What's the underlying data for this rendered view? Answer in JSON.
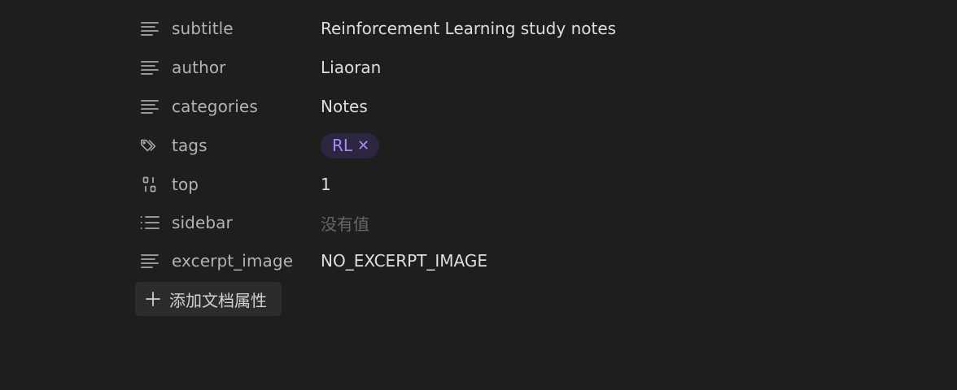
{
  "properties": [
    {
      "key": "subtitle",
      "icon": "text-lines-icon",
      "value": "Reinforcement Learning study notes"
    },
    {
      "key": "author",
      "icon": "text-lines-icon",
      "value": "Liaoran"
    },
    {
      "key": "categories",
      "icon": "text-lines-icon",
      "value": "Notes"
    },
    {
      "key": "tags",
      "icon": "tags-icon",
      "tags": [
        "RL"
      ]
    },
    {
      "key": "top",
      "icon": "number-icon",
      "value": "1"
    },
    {
      "key": "sidebar",
      "icon": "list-icon",
      "placeholder": "没有值"
    },
    {
      "key": "excerpt_image",
      "icon": "text-lines-icon",
      "value": "NO_EXCERPT_IMAGE"
    }
  ],
  "add_property_label": "添加文档属性",
  "tag_remove_symbol": "✕",
  "colors": {
    "background": "#1e1e1e",
    "tag_bg": "#2d2640",
    "tag_text": "#a78bfa",
    "button_bg": "#2c2c2c"
  }
}
